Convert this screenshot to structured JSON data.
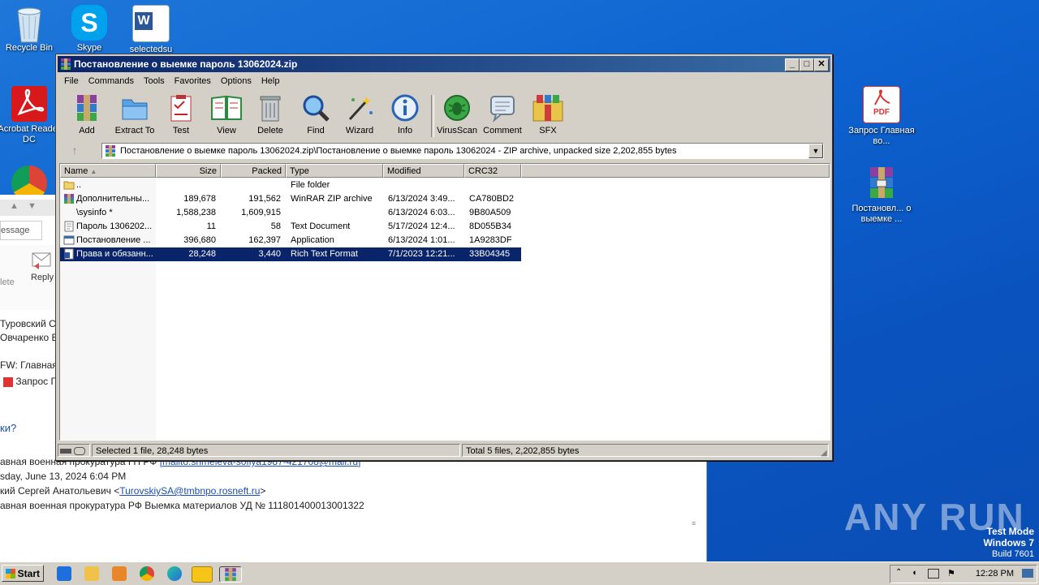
{
  "desktop": {
    "icons_left": [
      {
        "label": "Recycle Bin"
      },
      {
        "label": "Skype"
      },
      {
        "label": "selectedsu"
      },
      {
        "label": "Acrobat Reader DC"
      }
    ],
    "icons_right": [
      {
        "label": "Запрос Главная во..."
      },
      {
        "label": "Постановл... о выемке ..."
      }
    ]
  },
  "email": {
    "tab_label": "essage",
    "btn_delete": "lete",
    "btn_reply": "Reply",
    "to1": "Туровский Се",
    "to2": "Овчаренко В",
    "subject": "FW: Главная",
    "attachment": "Запрос Г",
    "question": "ки?",
    "line_from_pre": "авная военная прокуратура ГП РФ",
    "line_from_link": "[mailto:shmeleva-sofiya1987-421708@mail.ru]",
    "line_sent": "sday, June 13, 2024 6:04 PM",
    "line_to_pre": "кий Сергей Анатольевич <",
    "line_to_link": "TurovskiySA@tmbnpo.rosneft.ru",
    "line_to_post": ">",
    "line_subject": "авная военная прокуратура РФ Выемка материалов УД № 111801400013001322"
  },
  "winrar": {
    "title": "Постановление о выемке  пароль 13062024.zip",
    "menu": [
      "File",
      "Commands",
      "Tools",
      "Favorites",
      "Options",
      "Help"
    ],
    "tools": [
      {
        "label": "Add",
        "icon": "add-icon"
      },
      {
        "label": "Extract To",
        "icon": "extract-icon"
      },
      {
        "label": "Test",
        "icon": "test-icon"
      },
      {
        "label": "View",
        "icon": "view-icon"
      },
      {
        "label": "Delete",
        "icon": "delete-icon"
      },
      {
        "label": "Find",
        "icon": "find-icon"
      },
      {
        "label": "Wizard",
        "icon": "wizard-icon"
      },
      {
        "label": "Info",
        "icon": "info-icon"
      },
      {
        "label": "VirusScan",
        "icon": "virusscan-icon"
      },
      {
        "label": "Comment",
        "icon": "comment-icon"
      },
      {
        "label": "SFX",
        "icon": "sfx-icon"
      }
    ],
    "address": "Постановление о выемке  пароль 13062024.zip\\Постановление о выемке  пароль 13062024 - ZIP archive, unpacked size 2,202,855 bytes",
    "columns": {
      "name": "Name",
      "size": "Size",
      "packed": "Packed",
      "type": "Type",
      "modified": "Modified",
      "crc": "CRC32"
    },
    "rows": [
      {
        "name": "..",
        "size": "",
        "packed": "",
        "type": "File folder",
        "modified": "",
        "crc": "",
        "icon": "folder"
      },
      {
        "name": "Дополнительны...",
        "size": "189,678",
        "packed": "191,562",
        "type": "WinRAR ZIP archive",
        "modified": "6/13/2024 3:49...",
        "crc": "CA780BD2",
        "icon": "rar"
      },
      {
        "name": "\\sysinfo *",
        "size": "1,588,238",
        "packed": "1,609,915",
        "type": "",
        "modified": "6/13/2024 6:03...",
        "crc": "9B80A509",
        "icon": "none"
      },
      {
        "name": "Пароль 1306202...",
        "size": "11",
        "packed": "58",
        "type": "Text Document",
        "modified": "5/17/2024 12:4...",
        "crc": "8D055B34",
        "icon": "txt"
      },
      {
        "name": "Постановление ...",
        "size": "396,680",
        "packed": "162,397",
        "type": "Application",
        "modified": "6/13/2024 1:01...",
        "crc": "1A9283DF",
        "icon": "app"
      },
      {
        "name": "Права и обязанн...",
        "size": "28,248",
        "packed": "3,440",
        "type": "Rich Text Format",
        "modified": "7/1/2023 12:21...",
        "crc": "33B04345",
        "icon": "rtf"
      }
    ],
    "status_left": "Selected 1 file, 28,248 bytes",
    "status_right": "Total 5 files, 2,202,855 bytes"
  },
  "watermark": {
    "brand": "ANY RUN",
    "test_mode": "Test Mode",
    "os": "Windows 7",
    "build": "Build 7601"
  },
  "taskbar": {
    "start": "Start",
    "clock": "12:28 PM"
  }
}
